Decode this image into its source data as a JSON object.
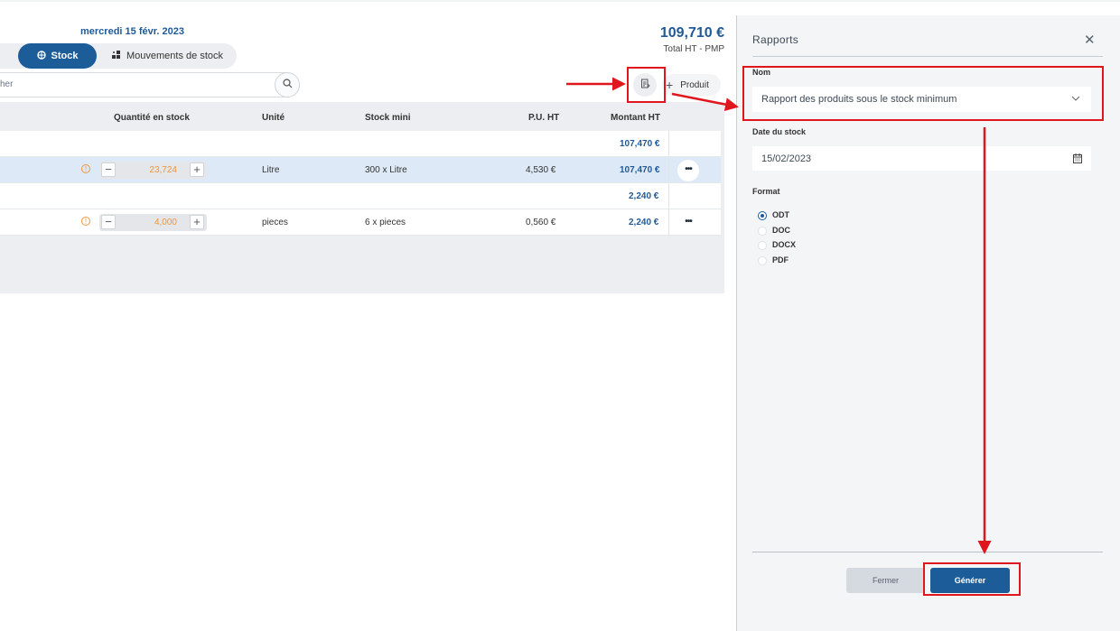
{
  "header": {
    "date": "mercredi 15 févr. 2023",
    "total_amount": "109,710 €",
    "total_label": "Total HT - PMP"
  },
  "tabs": [
    {
      "label": "Stock",
      "icon": "box-icon",
      "active": true
    },
    {
      "label": "Mouvements de stock",
      "icon": "grid-icon",
      "active": false
    }
  ],
  "search": {
    "placeholder_visible": "her"
  },
  "toolbar": {
    "add_product_label": "Produit",
    "add_icon": "plus-icon",
    "report_icon": "document-icon"
  },
  "table": {
    "headers": [
      "Quantité en stock",
      "Unité",
      "Stock mini",
      "P.U. HT",
      "Montant HT"
    ],
    "group1_total": "107,470 €",
    "row1": {
      "qty": "23,724",
      "unit": "Litre",
      "stock_mini": "300 x Litre",
      "pu": "4,530 €",
      "amount": "107,470 €",
      "more": "•••"
    },
    "group2_total": "2,240 €",
    "row2": {
      "qty": "4,000",
      "unit": "pieces",
      "stock_mini": "6 x pieces",
      "pu": "0,560 €",
      "amount": "2,240 €",
      "more": "•••"
    }
  },
  "panel": {
    "title": "Rapports",
    "close": "✕",
    "nom_label": "Nom",
    "nom_value": "Rapport des produits sous le stock minimum",
    "date_label": "Date du stock",
    "date_value": "15/02/2023",
    "format_label": "Format",
    "formats": [
      "ODT",
      "DOC",
      "DOCX",
      "PDF"
    ],
    "selected_format": "ODT",
    "fermer": "Fermer",
    "generer": "Générer"
  },
  "colors": {
    "primary": "#1c5c99",
    "warning": "#f0963c",
    "highlight": "#e0161e"
  }
}
